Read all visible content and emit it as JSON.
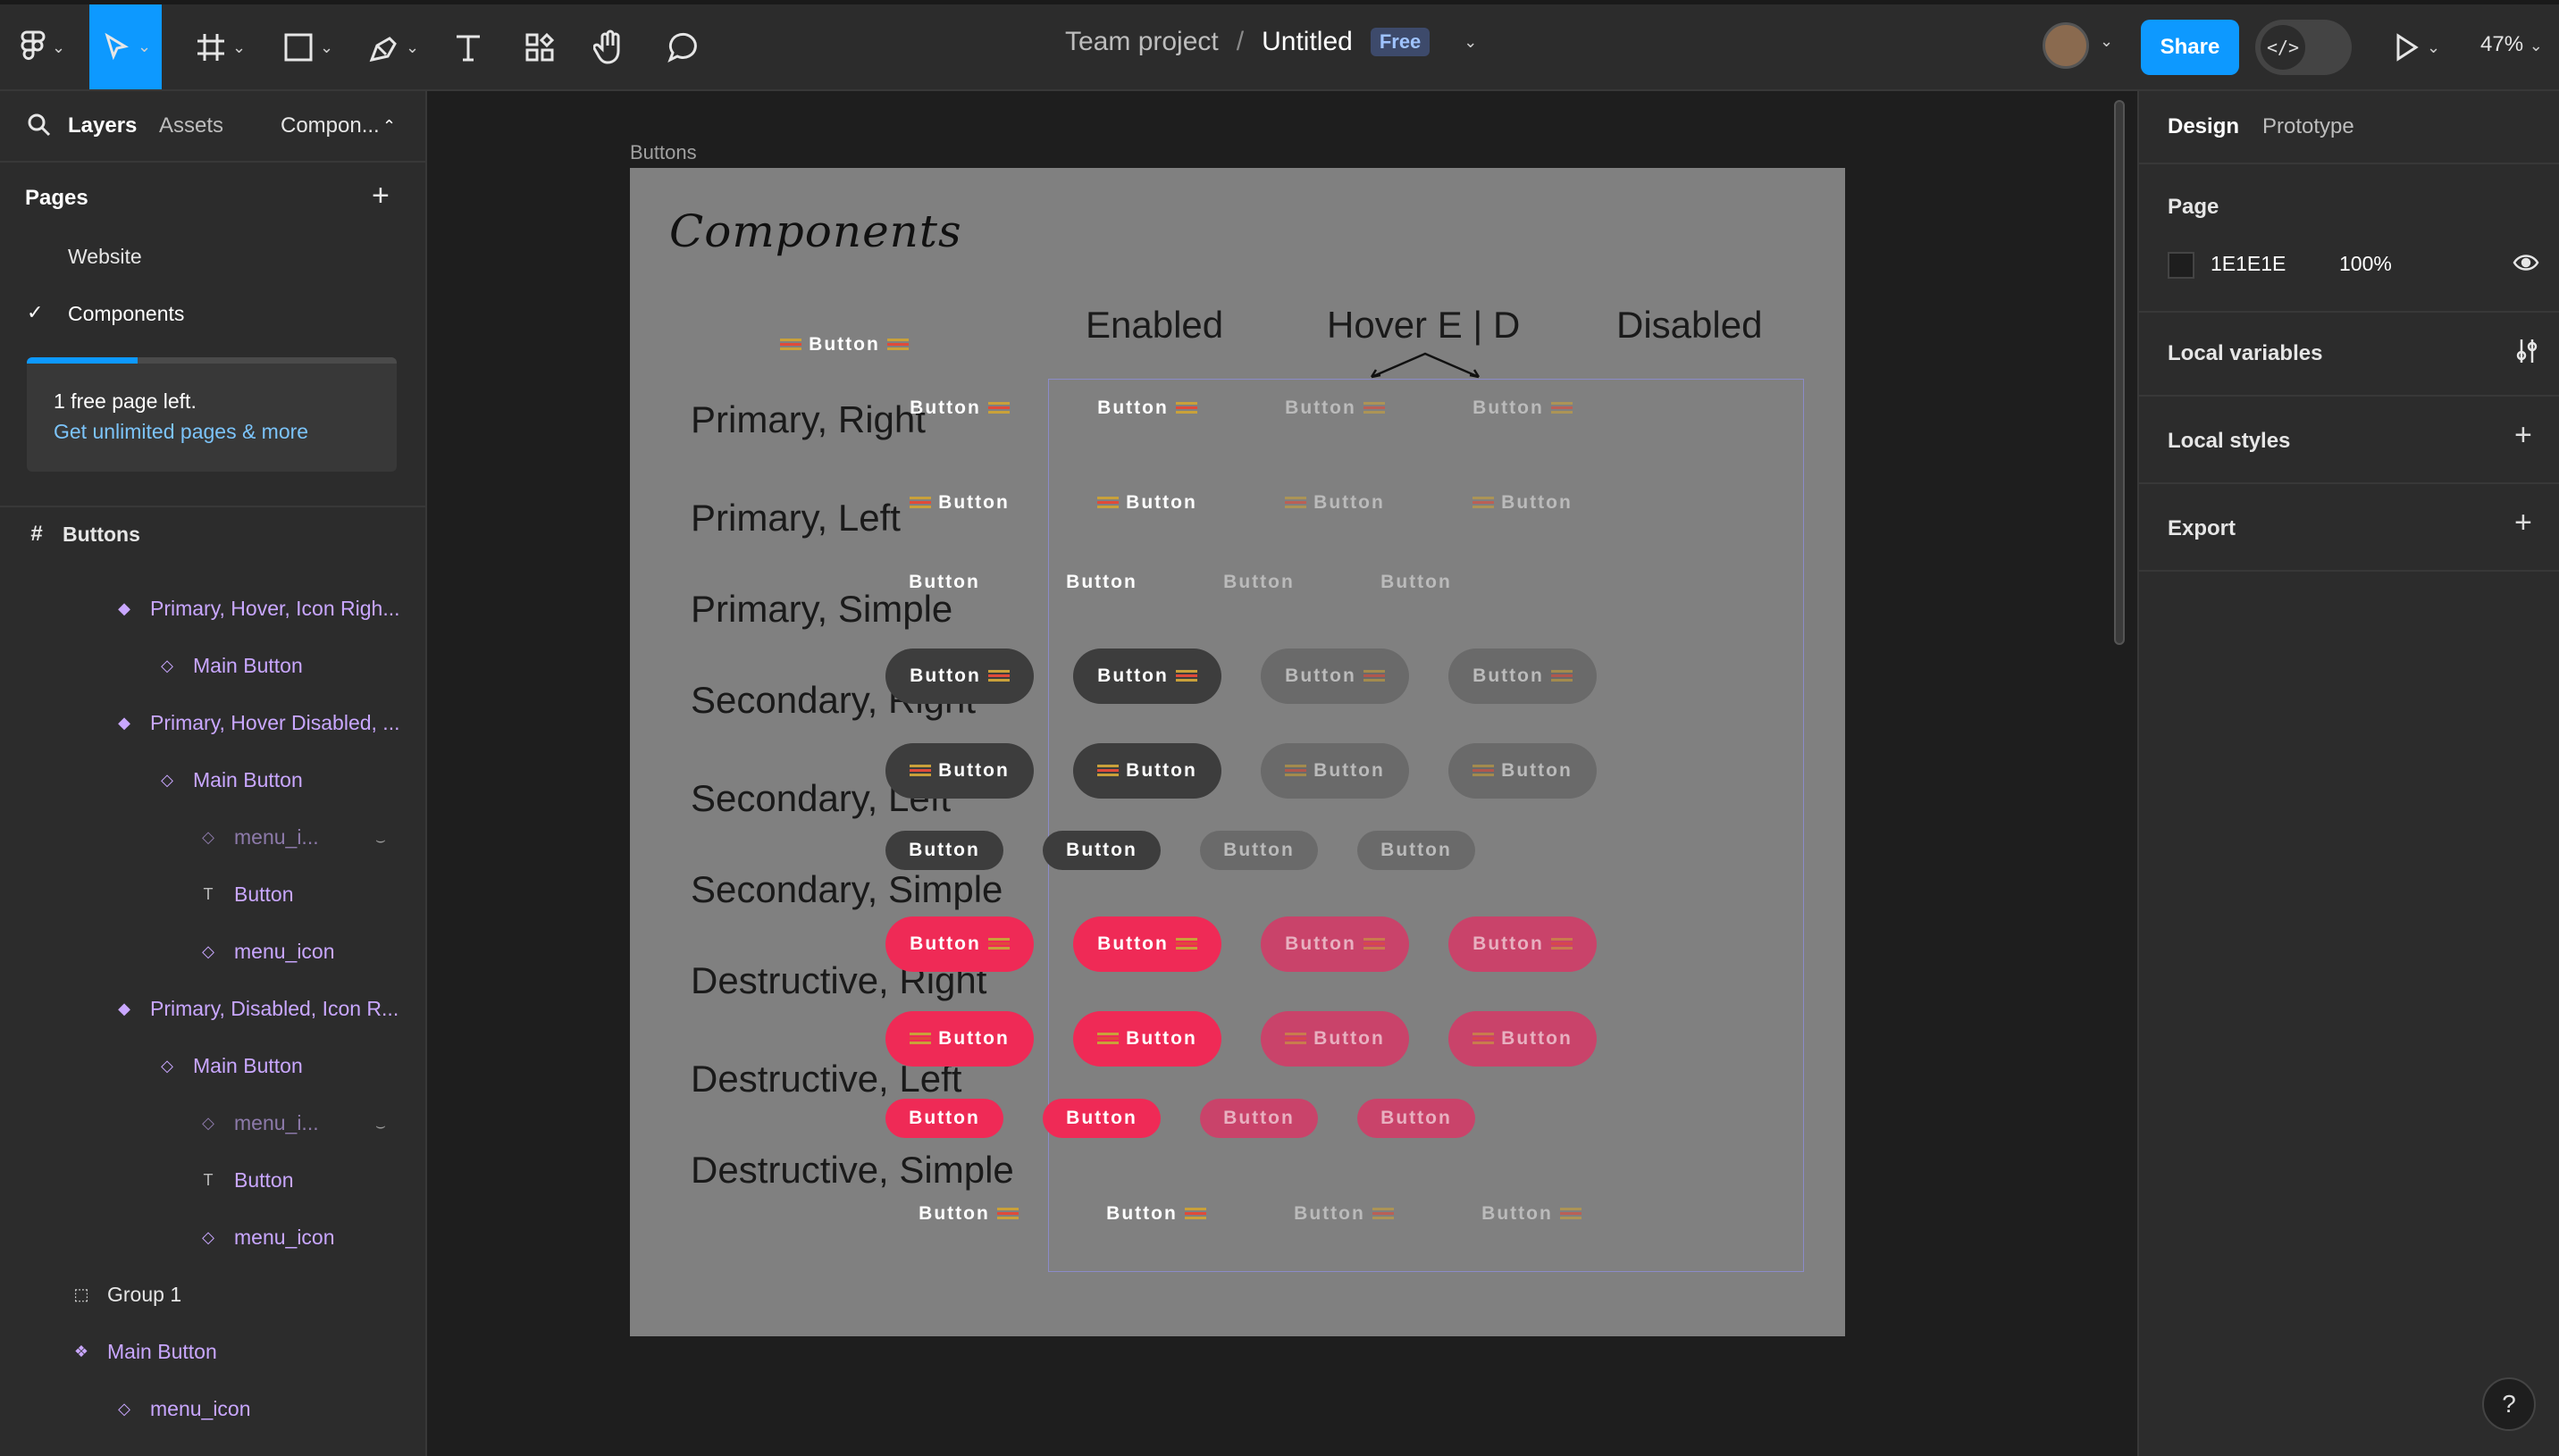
{
  "toolbar": {
    "project": "Team project",
    "separator": "/",
    "file_name": "Untitled",
    "plan_badge": "Free",
    "share_label": "Share",
    "dev_mode_icon": "</>",
    "zoom": "47%",
    "active_tool": "move"
  },
  "left_panel": {
    "tabs": {
      "layers": "Layers",
      "assets": "Assets",
      "components": "Compon..."
    },
    "pages_header": "Pages",
    "pages": [
      {
        "name": "Website",
        "selected": false
      },
      {
        "name": "Components",
        "selected": true
      }
    ],
    "upsell": {
      "text": "1 free page left.",
      "link": "Get unlimited pages & more",
      "progress": 0.5
    },
    "frame_name": "Buttons",
    "layers": [
      {
        "name": "Primary, Hover, Icon Righ...",
        "icon": "component-variant-icon",
        "hidden": false
      },
      {
        "name": "Main Button",
        "icon": "instance-icon",
        "hidden": false
      },
      {
        "name": "Primary, Hover Disabled, ...",
        "icon": "component-variant-icon",
        "hidden": false
      },
      {
        "name": "Main Button",
        "icon": "instance-icon",
        "hidden": false
      },
      {
        "name": "menu_i...",
        "icon": "instance-icon",
        "hidden": true
      },
      {
        "name": "Button",
        "icon": "text-icon",
        "hidden": false
      },
      {
        "name": "menu_icon",
        "icon": "instance-icon",
        "hidden": false
      },
      {
        "name": "Primary, Disabled, Icon R...",
        "icon": "component-variant-icon",
        "hidden": false
      },
      {
        "name": "Main Button",
        "icon": "instance-icon",
        "hidden": false
      },
      {
        "name": "menu_i...",
        "icon": "instance-icon",
        "hidden": true
      },
      {
        "name": "Button",
        "icon": "text-icon",
        "hidden": false
      },
      {
        "name": "menu_icon",
        "icon": "instance-icon",
        "hidden": false
      },
      {
        "name": "Group 1",
        "icon": "group-icon",
        "hidden": false
      },
      {
        "name": "Main Button",
        "icon": "component-set-icon",
        "hidden": false
      },
      {
        "name": "menu_icon",
        "icon": "instance-icon",
        "hidden": false
      }
    ]
  },
  "canvas": {
    "frame_label": "Buttons",
    "frame_title": "Components",
    "sample_button": "Button",
    "column_headers": [
      "Enabled",
      "Hover E | D",
      "Disabled"
    ],
    "row_labels": [
      "Primary, Right",
      "Primary, Left",
      "Primary, Simple",
      "Secondary, Right",
      "Secondary, Left",
      "Secondary, Simple",
      "Destructive, Right",
      "Destructive, Left",
      "Destructive, Simple"
    ],
    "button_text": "Button",
    "colors": {
      "frame_bg": "#808080",
      "secondary": "#3d3d3d",
      "secondary_disabled": "#6a6a6a",
      "destructive": "#ef2a56",
      "destructive_disabled": "#c9436a"
    }
  },
  "right_panel": {
    "tabs": {
      "design": "Design",
      "prototype": "Prototype"
    },
    "page_header": "Page",
    "page_color": "1E1E1E",
    "page_opacity": "100%",
    "local_variables": "Local variables",
    "local_styles": "Local styles",
    "export": "Export"
  },
  "help": "?"
}
